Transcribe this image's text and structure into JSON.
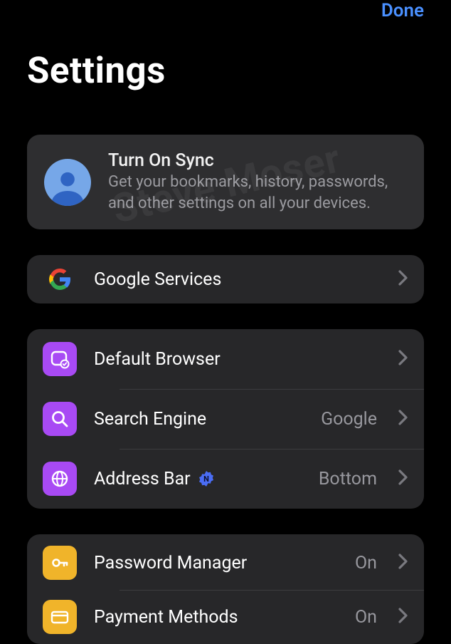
{
  "header": {
    "done_label": "Done"
  },
  "page_title": "Settings",
  "watermark": "Steve Moser",
  "sync": {
    "title": "Turn On Sync",
    "description": "Get your bookmarks, history, passwords, and other settings on all your devices."
  },
  "groups": [
    {
      "id": "services",
      "rows": [
        {
          "icon": "google-logo",
          "label": "Google Services",
          "value": ""
        }
      ]
    },
    {
      "id": "browser",
      "rows": [
        {
          "icon": "browser-check",
          "color": "purple",
          "label": "Default Browser",
          "value": ""
        },
        {
          "icon": "search",
          "color": "purple",
          "label": "Search Engine",
          "value": "Google"
        },
        {
          "icon": "globe",
          "color": "purple",
          "label": "Address Bar",
          "value": "Bottom",
          "badge": "N"
        }
      ]
    },
    {
      "id": "credentials",
      "rows": [
        {
          "icon": "key",
          "color": "amber",
          "label": "Password Manager",
          "value": "On"
        },
        {
          "icon": "card",
          "color": "amber",
          "label": "Payment Methods",
          "value": "On"
        }
      ]
    }
  ]
}
